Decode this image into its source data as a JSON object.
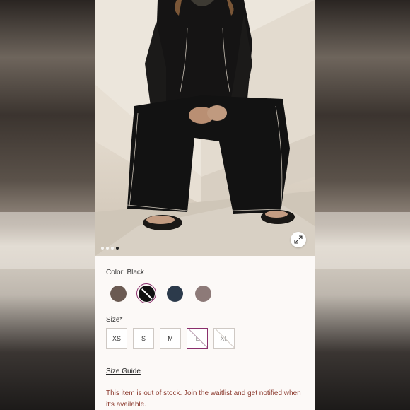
{
  "product": {
    "image_alt": "Model seated wearing black long-sleeve top and wide-leg pants with contrast stitching",
    "carousel": {
      "total": 4,
      "active_index": 3
    },
    "color": {
      "label": "Color: Black",
      "options": [
        {
          "name": "Brown",
          "hex": "#6b5a52",
          "selected": false,
          "available": true
        },
        {
          "name": "Black",
          "hex": "#111111",
          "selected": true,
          "available": false
        },
        {
          "name": "Navy",
          "hex": "#2c3a4b",
          "selected": false,
          "available": true
        },
        {
          "name": "Mauve",
          "hex": "#8d7a78",
          "selected": false,
          "available": true
        }
      ]
    },
    "size": {
      "label": "Size*",
      "options": [
        {
          "label": "XS",
          "selected": false,
          "available": true
        },
        {
          "label": "S",
          "selected": false,
          "available": true
        },
        {
          "label": "M",
          "selected": false,
          "available": true
        },
        {
          "label": "L",
          "selected": true,
          "available": false
        },
        {
          "label": "XL",
          "selected": false,
          "available": false
        }
      ]
    },
    "size_guide_label": "Size Guide",
    "out_of_stock_message": "This item is out of stock. Join the waitlist and get notified when it's available."
  },
  "colors": {
    "accent": "#8a2f6c",
    "oos_text": "#8b3a2e"
  },
  "icons": {
    "expand": "expand-arrows-icon"
  }
}
